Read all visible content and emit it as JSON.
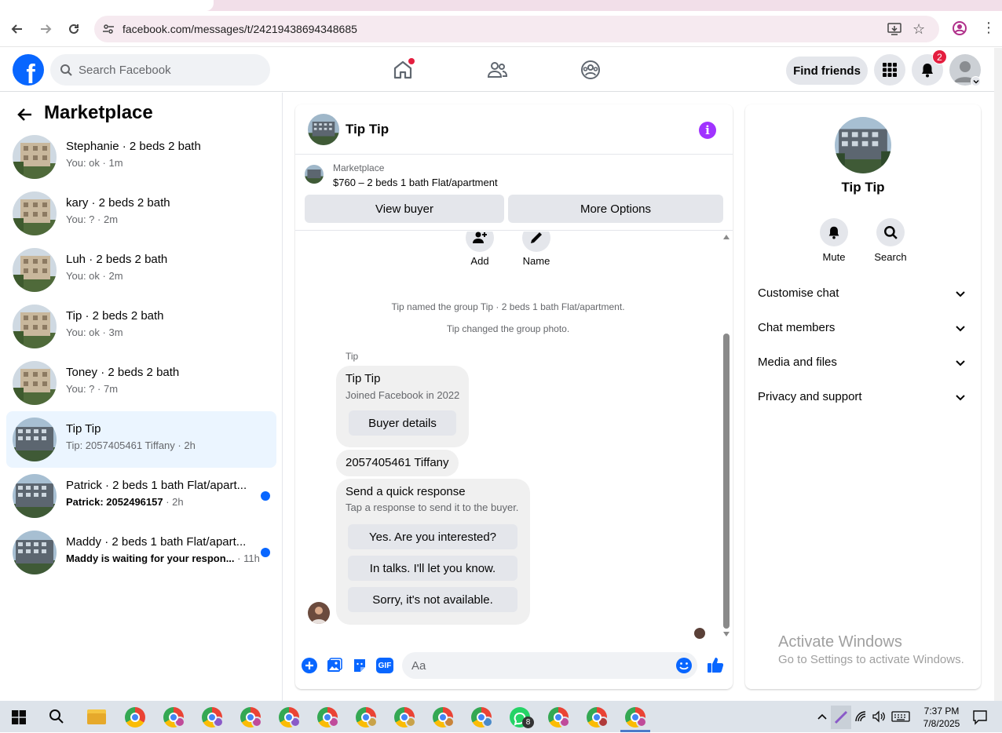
{
  "browser": {
    "url": "facebook.com/messages/t/24219438694348685"
  },
  "header": {
    "search_placeholder": "Search Facebook",
    "find_friends": "Find friends",
    "notification_count": "2",
    "logo_letter": "f"
  },
  "sidebar": {
    "title": "Marketplace",
    "conversations": [
      {
        "name": "Stephanie · 2 beds 2 bath",
        "preview": "You: ok",
        "time": "1m",
        "unread": false,
        "active": false
      },
      {
        "name": "kary · 2 beds 2 bath",
        "preview": "You: ?",
        "time": "2m",
        "unread": false,
        "active": false
      },
      {
        "name": "Luh · 2 beds 2 bath",
        "preview": "You: ok",
        "time": "2m",
        "unread": false,
        "active": false
      },
      {
        "name": "Tip · 2 beds 2 bath",
        "preview": "You: ok",
        "time": "3m",
        "unread": false,
        "active": false
      },
      {
        "name": "Toney · 2 beds 2 bath",
        "preview": "You: ?",
        "time": "7m",
        "unread": false,
        "active": false
      },
      {
        "name": "Tip Tip",
        "preview": "Tip: 2057405461 Tiffany",
        "time": "2h",
        "unread": false,
        "active": true
      },
      {
        "name": "Patrick · 2 beds 1 bath Flat/apart...",
        "preview": "Patrick: 2052496157",
        "time": "2h",
        "unread": true,
        "active": false
      },
      {
        "name": "Maddy · 2 beds 1 bath Flat/apart...",
        "preview": "Maddy is waiting for your respon...",
        "time": "11h",
        "unread": true,
        "active": false
      }
    ]
  },
  "chat": {
    "title": "Tip Tip",
    "listing_category": "Marketplace",
    "listing_title": "$760 – 2 beds 1 bath Flat/apartment",
    "view_buyer": "View buyer",
    "more_options": "More Options",
    "actions": {
      "add": "Add",
      "name": "Name"
    },
    "system_messages": [
      "Tip named the group Tip · 2 beds 1 bath Flat/apartment.",
      "Tip changed the group photo."
    ],
    "sender": "Tip",
    "profile_card": {
      "name": "Tip Tip",
      "joined": "Joined Facebook in 2022",
      "button": "Buyer details"
    },
    "message": "2057405461 Tiffany",
    "quick_response": {
      "title": "Send a quick response",
      "subtitle": "Tap a response to send it to the buyer.",
      "options": [
        "Yes. Are you interested?",
        "In talks. I'll let you know.",
        "Sorry, it's not available."
      ]
    },
    "composer_placeholder": "Aa",
    "gif_label": "GIF"
  },
  "right_panel": {
    "name": "Tip Tip",
    "mute": "Mute",
    "search": "Search",
    "sections": [
      "Customise chat",
      "Chat members",
      "Media and files",
      "Privacy and support"
    ]
  },
  "watermark": {
    "line1": "Activate Windows",
    "line2": "Go to Settings to activate Windows."
  },
  "taskbar": {
    "time": "7:37 PM",
    "date": "7/8/2025",
    "whatsapp_badge": "8"
  },
  "colors": {
    "fb_blue": "#0866ff",
    "unread_dot": "#0866ff",
    "info_purple": "#a033ff",
    "badge_red": "#e41e3f"
  }
}
